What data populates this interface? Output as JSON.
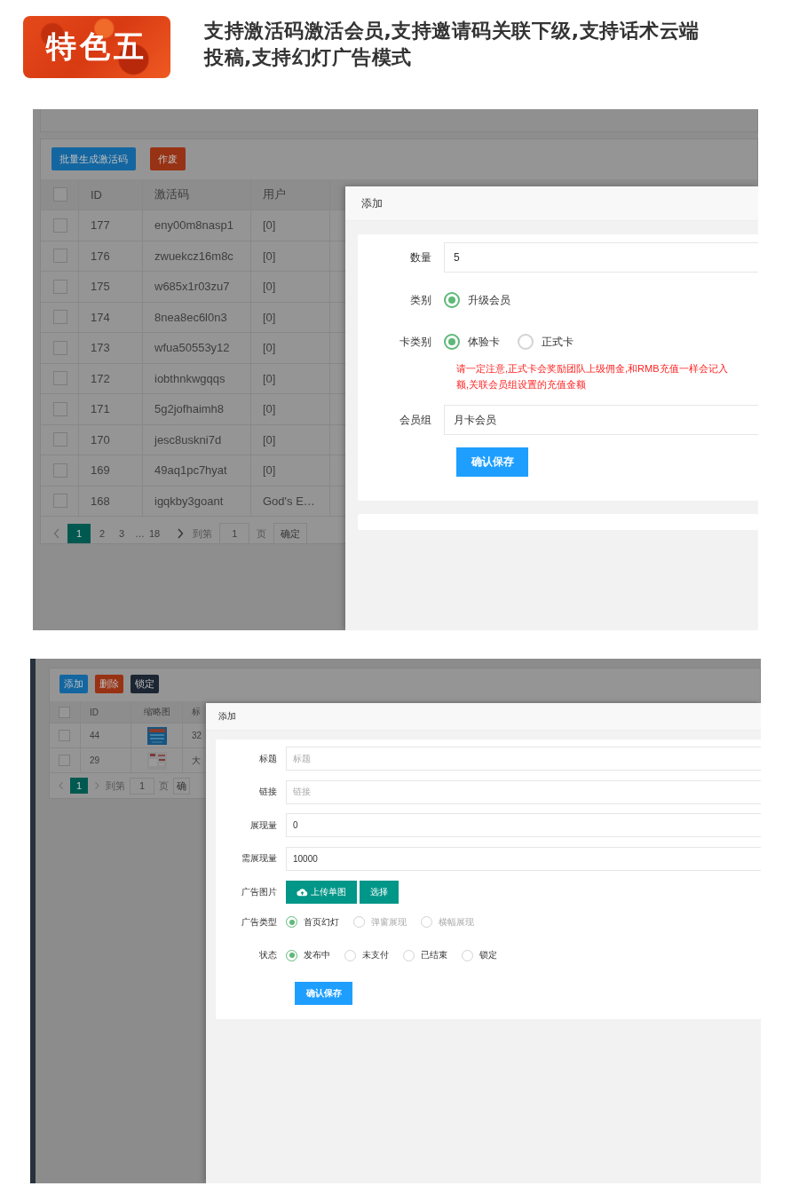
{
  "header": {
    "badge": "特色五",
    "headline_lines": [
      "支持激活码激活会员,支持邀请码关联下级,支持话术云端",
      "投稿,支持幻灯广告模式"
    ]
  },
  "screen_1": {
    "toolbar": [
      {
        "label": "批量生成激活码",
        "kind": "primary"
      },
      {
        "label": "作废",
        "kind": "danger"
      }
    ],
    "table": {
      "header_checked": false,
      "columns": [
        "ID",
        "激活码",
        "用户"
      ],
      "rows": [
        {
          "checked": false,
          "cells": [
            "177",
            "eny00m8nasp1",
            "[0]"
          ]
        },
        {
          "checked": false,
          "cells": [
            "176",
            "zwuekcz16m8c",
            "[0]"
          ]
        },
        {
          "checked": false,
          "cells": [
            "175",
            "w685x1r03zu7",
            "[0]"
          ]
        },
        {
          "checked": false,
          "cells": [
            "174",
            "8nea8ec6l0n3",
            "[0]"
          ]
        },
        {
          "checked": false,
          "cells": [
            "173",
            "wfua50553y12",
            "[0]"
          ]
        },
        {
          "checked": false,
          "cells": [
            "172",
            "iobthnkwgqqs",
            "[0]"
          ]
        },
        {
          "checked": false,
          "cells": [
            "171",
            "5g2jofhaimh8",
            "[0]"
          ]
        },
        {
          "checked": false,
          "cells": [
            "170",
            "jesc8uskni7d",
            "[0]"
          ]
        },
        {
          "checked": false,
          "cells": [
            "169",
            "49aq1pc7hyat",
            "[0]"
          ]
        },
        {
          "checked": false,
          "cells": [
            "168",
            "igqkby3goant",
            "God's E…"
          ]
        }
      ]
    },
    "pagination": {
      "pages": [
        {
          "label": "1",
          "kind": "page",
          "selected": true
        },
        {
          "label": "2",
          "kind": "page",
          "selected": false
        },
        {
          "label": "3",
          "kind": "page",
          "selected": false
        },
        {
          "label": "…",
          "kind": "ellipsis"
        },
        {
          "label": "18",
          "kind": "page",
          "selected": false
        }
      ],
      "goto_label": "到第",
      "goto_value": "1",
      "page_unit": "页",
      "confirm": "确定"
    },
    "modal": {
      "title": "添加",
      "fields": [
        {
          "kind": "input",
          "label": "数量",
          "value": "5"
        },
        {
          "kind": "radio",
          "label": "类别",
          "options": [
            {
              "label": "升级会员",
              "selected": true
            }
          ]
        },
        {
          "kind": "radio",
          "label": "卡类别",
          "options": [
            {
              "label": "体验卡",
              "selected": true
            },
            {
              "label": "正式卡",
              "selected": false
            }
          ],
          "notice": [
            "请一定注意,正式卡会奖励团队上级佣金,和RMB充值一样会记入",
            "额,关联会员组设置的充值金额"
          ]
        },
        {
          "kind": "input",
          "label": "会员组",
          "value": "月卡会员"
        }
      ],
      "submit": "确认保存"
    }
  },
  "screen_2": {
    "toolbar": [
      {
        "label": "添加",
        "kind": "primary"
      },
      {
        "label": "删除",
        "kind": "danger"
      },
      {
        "label": "锁定",
        "kind": "dark"
      }
    ],
    "table": {
      "header_checked": false,
      "columns": [
        "ID",
        "缩略图",
        "标"
      ],
      "rows": [
        {
          "checked": false,
          "id": "44",
          "column_4": "32"
        },
        {
          "checked": false,
          "id": "29",
          "column_4": "大"
        }
      ]
    },
    "pagination": {
      "pages": [
        {
          "label": "1",
          "kind": "page",
          "selected": true
        }
      ],
      "goto_label": "到第",
      "goto_value": "1",
      "page_unit": "页",
      "confirm": "确"
    },
    "modal": {
      "title": "添加",
      "fields": [
        {
          "kind": "input",
          "label": "标题",
          "placeholder": "标题"
        },
        {
          "kind": "input",
          "label": "链接",
          "placeholder": "链接"
        },
        {
          "kind": "input",
          "label": "展现量",
          "value": "0"
        },
        {
          "kind": "input",
          "label": "需展现量",
          "value": "10000"
        },
        {
          "kind": "upload",
          "label": "广告图片",
          "buttons": [
            "上传单图",
            "选择"
          ]
        },
        {
          "kind": "radio",
          "label": "广告类型",
          "options": [
            {
              "label": "首页幻灯",
              "selected": true,
              "disabled": false
            },
            {
              "label": "弹窗展现",
              "selected": false,
              "disabled": true
            },
            {
              "label": "横幅展现",
              "selected": false,
              "disabled": true
            }
          ]
        },
        {
          "kind": "radio",
          "label": "状态",
          "options": [
            {
              "label": "发布中",
              "selected": true,
              "disabled": false
            },
            {
              "label": "未支付",
              "selected": false,
              "disabled": false
            },
            {
              "label": "已结束",
              "selected": false,
              "disabled": false
            },
            {
              "label": "锁定",
              "selected": false,
              "disabled": false
            }
          ]
        }
      ],
      "submit": "确认保存"
    }
  }
}
